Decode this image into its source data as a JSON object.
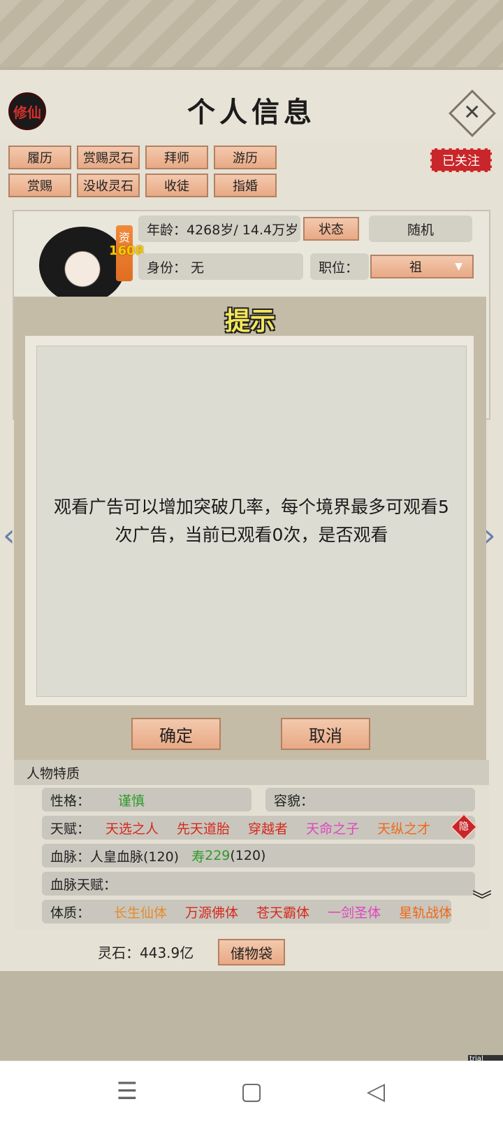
{
  "title": "个人信息",
  "badge_label": "修仙",
  "close_glyph": "✕",
  "followed_label": "已关注",
  "action_buttons": [
    "履历",
    "赏赐灵石",
    "拜师",
    "游历",
    "赏赐",
    "没收灵石",
    "收徒",
    "指婚"
  ],
  "profile": {
    "zi_label": "资",
    "zi_value": "1608",
    "age_text": "年龄：4268岁/ 14.4万岁",
    "status_button": "状态",
    "random_button": "随机",
    "identity_text": "身份：  无",
    "position_label": "职位：",
    "position_value": "祖"
  },
  "modal": {
    "title": "提示",
    "message": "观看广告可以增加突破几率，每个境界最多可观看5次广告，当前已观看0次，是否观看",
    "confirm_label": "确定",
    "cancel_label": "取消"
  },
  "traits": {
    "header": "人物特质",
    "personality_label": "性格：",
    "personality_value": "谨慎",
    "appearance_label": "容貌：",
    "talent_label": "天赋：",
    "talents": [
      {
        "text": "天选之人",
        "color": "#d42a1f"
      },
      {
        "text": "先天道胎",
        "color": "#d42a1f"
      },
      {
        "text": "穿越者",
        "color": "#d42a1f"
      },
      {
        "text": "天命之子",
        "color": "#e046c0"
      },
      {
        "text": "天纵之才",
        "color": "#ee6a1a"
      }
    ],
    "hidden_badge": "隐",
    "bloodline_label": "血脉：人皇血脉(120)",
    "bloodline_life_prefix": "寿",
    "bloodline_life_value": "229",
    "bloodline_life_suffix": "(120)",
    "bloodline_talent_label": "血脉天赋：",
    "physique_label": "体质：",
    "physiques": [
      {
        "text": "长生仙体",
        "color": "#e78a2a"
      },
      {
        "text": "万源佛体",
        "color": "#d42a1f"
      },
      {
        "text": "苍天霸体",
        "color": "#d42a1f"
      },
      {
        "text": "一剑圣体",
        "color": "#e046c0"
      },
      {
        "text": "星轨战体",
        "color": "#ee6a1a"
      }
    ]
  },
  "footer": {
    "lingshi_text": "灵石：443.9亿",
    "bag_label": "储物袋"
  },
  "watermark": "trial version",
  "nav": {
    "menu_glyph": "☰",
    "home_glyph": "▢",
    "back_glyph": "◁"
  }
}
